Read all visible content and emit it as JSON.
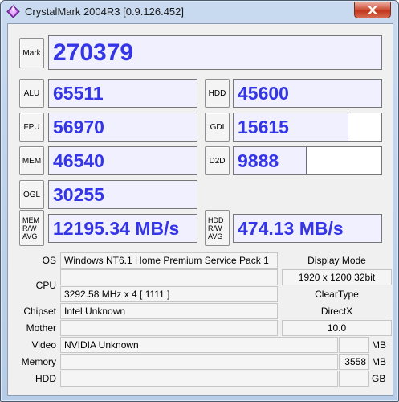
{
  "window": {
    "title": "CrystalMark 2004R3 [0.9.126.452]",
    "icons": {
      "app": "crystalmark-app-icon",
      "close": "close-icon"
    }
  },
  "scores": {
    "mark": {
      "label": "Mark",
      "value": "270379"
    },
    "alu": {
      "label": "ALU",
      "value": "65511",
      "level": 1.0
    },
    "fpu": {
      "label": "FPU",
      "value": "56970",
      "level": 1.0
    },
    "mem": {
      "label": "MEM",
      "value": "46540",
      "level": 1.0
    },
    "ogl": {
      "label": "OGL",
      "value": "30255",
      "level": 1.0
    },
    "mem_rw_avg": {
      "label_lines": [
        "MEM",
        "R/W",
        "AVG"
      ],
      "value": "12195.34 MB/s",
      "level": 1.0
    },
    "hdd": {
      "label": "HDD",
      "value": "45600",
      "level": 1.0
    },
    "gdi": {
      "label": "GDI",
      "value": "15615",
      "level": 0.77
    },
    "d2d": {
      "label": "D2D",
      "value": "9888",
      "level": 0.49
    },
    "hdd_rw_avg": {
      "label_lines": [
        "HDD",
        "R/W",
        "AVG"
      ],
      "value": "474.13 MB/s",
      "level": 1.0
    }
  },
  "info": {
    "os": {
      "label": "OS",
      "value": "Windows NT6.1 Home Premium Service Pack 1"
    },
    "cpu": {
      "label": "CPU",
      "line1": "",
      "line2": "3292.58 MHz x 4 [ 1111 ]"
    },
    "chipset": {
      "label": "Chipset",
      "value": "Intel Unknown"
    },
    "mother": {
      "label": "Mother",
      "value": ""
    },
    "video": {
      "label": "Video",
      "value": "NVIDIA Unknown",
      "size": "",
      "unit": "MB"
    },
    "memory": {
      "label": "Memory",
      "value": "",
      "size": "3558",
      "unit": "MB"
    },
    "hdd": {
      "label": "HDD",
      "value": "",
      "size": "",
      "unit": "GB"
    },
    "display_mode": {
      "label": "Display Mode",
      "value": "1920 x 1200 32bit"
    },
    "cleartype": {
      "label": "ClearType",
      "value": ""
    },
    "directx": {
      "label": "DirectX",
      "value": "10.0"
    }
  },
  "colors": {
    "score_text": "#3535e8",
    "score_fill": "#f1f0ff",
    "window_frame": "#b7cce6",
    "close_button": "#c2341b"
  }
}
